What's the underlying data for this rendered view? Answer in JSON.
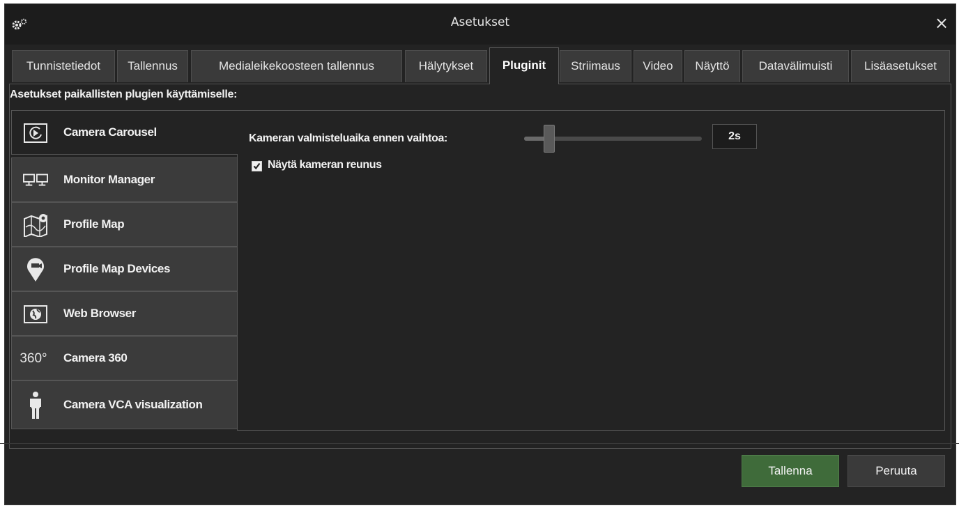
{
  "window": {
    "title": "Asetukset",
    "close_glyph": "×"
  },
  "tabs": [
    {
      "label": "Tunnistetiedot",
      "active": false
    },
    {
      "label": "Tallennus",
      "active": false
    },
    {
      "label": "Medialeikekoosteen tallennus",
      "active": false
    },
    {
      "label": "Hälytykset",
      "active": false
    },
    {
      "label": "Pluginit",
      "active": true
    },
    {
      "label": "Striimaus",
      "active": false
    },
    {
      "label": "Video",
      "active": false
    },
    {
      "label": "Näyttö",
      "active": false
    },
    {
      "label": "Datavälimuisti",
      "active": false
    },
    {
      "label": "Lisäasetukset",
      "active": false
    }
  ],
  "section_title": "Asetukset paikallisten plugien käyttämiselle:",
  "plugins": [
    {
      "label": "Camera Carousel",
      "icon": "camera-carousel-icon",
      "selected": true
    },
    {
      "label": "Monitor Manager",
      "icon": "monitors-icon",
      "selected": false
    },
    {
      "label": "Profile Map",
      "icon": "map-icon",
      "selected": false
    },
    {
      "label": "Profile Map Devices",
      "icon": "map-pin-camera-icon",
      "selected": false
    },
    {
      "label": "Web Browser",
      "icon": "globe-icon",
      "selected": false
    },
    {
      "label": "Camera 360",
      "icon": "camera-360-icon",
      "icon_text": "360°",
      "selected": false
    },
    {
      "label": "Camera VCA visualization",
      "icon": "person-icon",
      "selected": false
    }
  ],
  "settings": {
    "slider_label": "Kameran valmisteluaika ennen vaihtoa:",
    "slider_position": 0.14,
    "value": "2s",
    "checkbox_label": "Näytä kameran reunus",
    "checkbox_checked": true
  },
  "buttons": {
    "save": "Tallenna",
    "cancel": "Peruuta"
  },
  "colors": {
    "background": "#232323",
    "save_button": "#3f6b3a",
    "tab": "#3a3a3a"
  }
}
